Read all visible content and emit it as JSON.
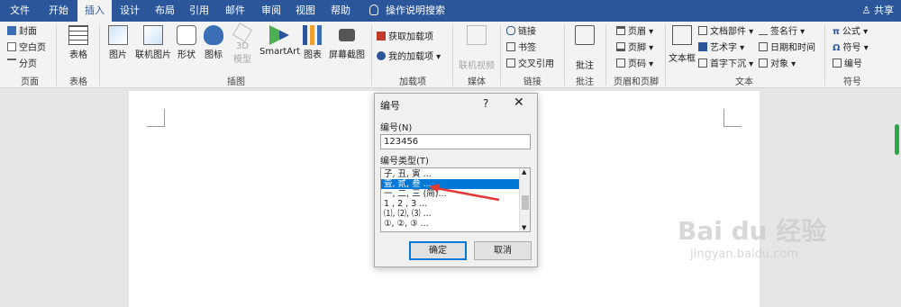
{
  "tabs": [
    "文件",
    "开始",
    "插入",
    "设计",
    "布局",
    "引用",
    "邮件",
    "审阅",
    "视图",
    "帮助"
  ],
  "tell_me": "操作说明搜索",
  "share": "共享",
  "ribbon": {
    "pages": {
      "cover": "封面",
      "blank": "空白页",
      "break": "分页",
      "label": "页面"
    },
    "table": {
      "btn": "表格",
      "label": "表格"
    },
    "illustrations": {
      "picture": "图片",
      "online_picture": "联机图片",
      "shapes": "形状",
      "icons": "图标",
      "model3d_line1": "3D",
      "model3d_line2": "模型",
      "smartart": "SmartArt",
      "chart": "图表",
      "screenshot": "屏幕截图",
      "label": "插图"
    },
    "addins": {
      "get": "获取加载项",
      "mine": "我的加载项",
      "label": "加载项"
    },
    "media": {
      "video": "联机视频",
      "label": "媒体"
    },
    "links": {
      "link": "链接",
      "bookmark": "书签",
      "xref": "交叉引用",
      "label": "链接"
    },
    "comments": {
      "comment": "批注",
      "label": "批注"
    },
    "header_footer": {
      "header": "页眉",
      "footer": "页脚",
      "page_number": "页码",
      "label": "页眉和页脚"
    },
    "text": {
      "textbox": "文本框",
      "quick_parts": "文档部件",
      "wordart": "艺术字",
      "dropcap": "首字下沉",
      "signature": "签名行",
      "datetime": "日期和时间",
      "object": "对象",
      "label": "文本"
    },
    "symbols": {
      "equation": "公式",
      "symbol": "符号",
      "number": "编号",
      "label": "符号"
    }
  },
  "dialog": {
    "title": "编号",
    "help": "?",
    "number_label": "编号(N)",
    "number_value": "123456",
    "type_label": "编号类型(T)",
    "types": [
      "子, 丑, 寅 ...",
      "壹, 贰, 叁 ...",
      "一, 二, 三 (简)...",
      "1 , 2 , 3 ...",
      "⑴, ⑵, ⑶ ...",
      "①, ②, ③ ..."
    ],
    "selected_index": 1,
    "ok": "确定",
    "cancel": "取消"
  },
  "watermark": {
    "line1": "Bai du 经验",
    "line2": "jingyan.baidu.com"
  }
}
